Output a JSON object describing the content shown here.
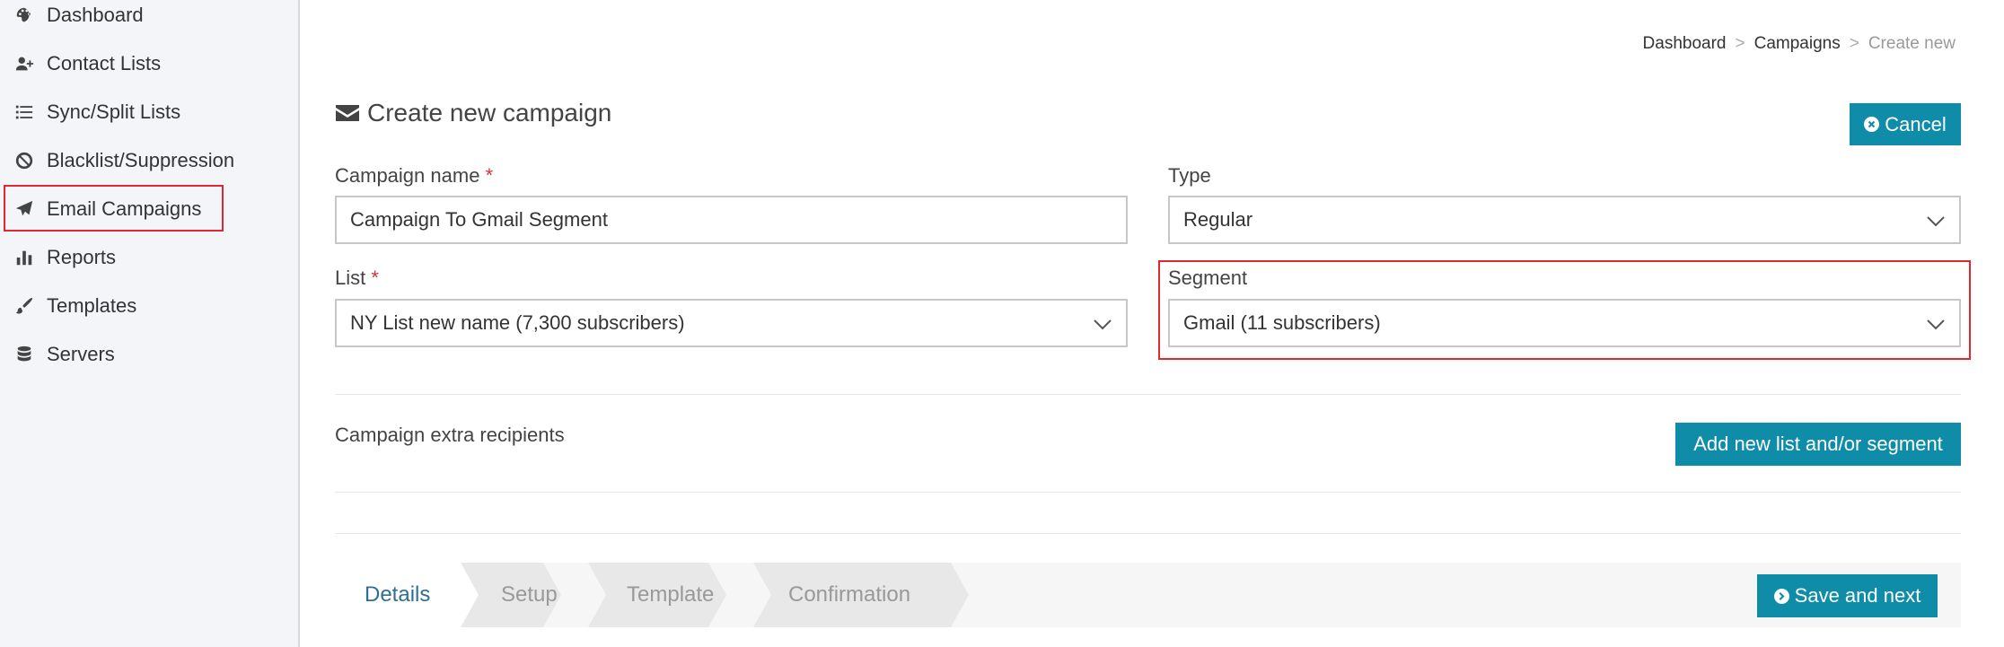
{
  "sidebar": {
    "items": [
      {
        "label": "Dashboard",
        "icon": "palette-icon"
      },
      {
        "label": "Contact Lists",
        "icon": "user-plus-icon"
      },
      {
        "label": "Sync/Split Lists",
        "icon": "list-icon"
      },
      {
        "label": "Blacklist/Suppression",
        "icon": "ban-icon"
      },
      {
        "label": "Email Campaigns",
        "icon": "paper-plane-icon"
      },
      {
        "label": "Reports",
        "icon": "bar-chart-icon"
      },
      {
        "label": "Templates",
        "icon": "brush-icon"
      },
      {
        "label": "Servers",
        "icon": "database-icon"
      }
    ]
  },
  "breadcrumb": {
    "items": [
      "Dashboard",
      "Campaigns",
      "Create new"
    ],
    "separator": ">"
  },
  "page": {
    "title": "Create new campaign",
    "cancel_label": "Cancel"
  },
  "form": {
    "campaign_name": {
      "label": "Campaign name",
      "required_mark": "*",
      "value": "Campaign To Gmail Segment"
    },
    "type": {
      "label": "Type",
      "value": "Regular"
    },
    "list": {
      "label": "List",
      "required_mark": "*",
      "value": "NY List new name (7,300 subscribers)"
    },
    "segment": {
      "label": "Segment",
      "value": "Gmail (11 subscribers)"
    }
  },
  "extra_recipients": {
    "label": "Campaign extra recipients",
    "add_button_label": "Add new list and/or segment"
  },
  "wizard": {
    "steps": [
      "Details",
      "Setup",
      "Template",
      "Confirmation"
    ],
    "active_step": "Details",
    "save_next_label": "Save and next"
  },
  "colors": {
    "accent": "#0f8ca8",
    "highlight": "#e0282e",
    "required": "#d0343a",
    "active_step": "#2f6f96"
  }
}
